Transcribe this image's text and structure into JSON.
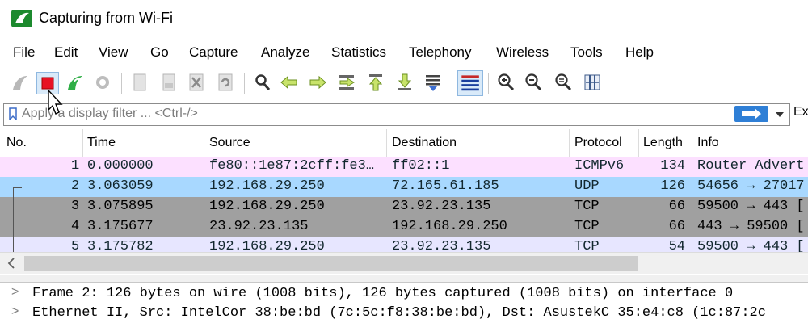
{
  "window": {
    "title": "Capturing from Wi-Fi",
    "app_icon": "wireshark-fin-icon"
  },
  "menu": [
    "File",
    "Edit",
    "View",
    "Go",
    "Capture",
    "Analyze",
    "Statistics",
    "Telephony",
    "Wireless",
    "Tools",
    "Help"
  ],
  "toolbar": {
    "icons": [
      "shark-fin-start-icon",
      "stop-capture-icon",
      "restart-capture-icon",
      "capture-options-icon",
      "open-file-icon",
      "save-file-icon",
      "close-file-icon",
      "reload-icon",
      "find-packet-icon",
      "go-back-icon",
      "go-forward-icon",
      "go-to-packet-icon",
      "first-packet-icon",
      "last-packet-icon",
      "autoscroll-icon",
      "colorize-icon",
      "zoom-in-icon",
      "zoom-out-icon",
      "normal-size-icon",
      "resize-columns-icon"
    ]
  },
  "filter": {
    "placeholder": "Apply a display filter ... <Ctrl-/>",
    "value": "",
    "expression_label": "Ex"
  },
  "packet_list": {
    "columns": [
      "No.",
      "Time",
      "Source",
      "Destination",
      "Protocol",
      "Length",
      "Info"
    ],
    "rows": [
      {
        "no": "1",
        "time": "0.000000",
        "source": "fe80::1e87:2cff:fe3…",
        "destination": "ff02::1",
        "protocol": "ICMPv6",
        "length": "134",
        "info": "Router Advert",
        "bg": "#fce0ff",
        "fg": "#12272e"
      },
      {
        "no": "2",
        "time": "3.063059",
        "source": "192.168.29.250",
        "destination": "72.165.61.185",
        "protocol": "UDP",
        "length": "126",
        "info": "54656 → 27017",
        "bg": "#a8d8ff",
        "fg": "#12272e",
        "selected": true
      },
      {
        "no": "3",
        "time": "3.075895",
        "source": "192.168.29.250",
        "destination": "23.92.23.135",
        "protocol": "TCP",
        "length": "66",
        "info": "59500 → 443 [",
        "bg": "#a0a0a0",
        "fg": "#000000"
      },
      {
        "no": "4",
        "time": "3.175677",
        "source": "23.92.23.135",
        "destination": "192.168.29.250",
        "protocol": "TCP",
        "length": "66",
        "info": "443 → 59500 [",
        "bg": "#a0a0a0",
        "fg": "#000000"
      },
      {
        "no": "5",
        "time": "3.175782",
        "source": "192.168.29.250",
        "destination": "23.92.23.135",
        "protocol": "TCP",
        "length": "54",
        "info": "59500 → 443 [",
        "bg": "#e7e6ff",
        "fg": "#12272e"
      }
    ]
  },
  "details": [
    "Frame 2: 126 bytes on wire (1008 bits), 126 bytes captured (1008 bits) on interface 0",
    "Ethernet II, Src: IntelCor_38:be:bd (7c:5c:f8:38:be:bd), Dst: AsustekC_35:e4:c8 (1c:87:2c"
  ]
}
